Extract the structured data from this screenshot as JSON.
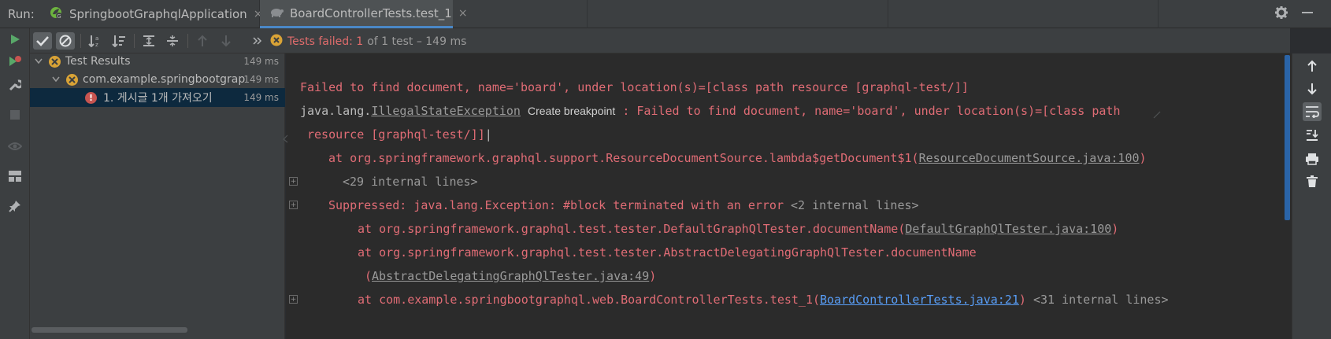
{
  "run_label": "Run:",
  "tabs": [
    {
      "label": "SpringbootGraphqlApplication",
      "close": "×"
    },
    {
      "label": "BoardControllerTests.test_1",
      "close": "×"
    }
  ],
  "status": {
    "failed_text": "Tests failed: 1",
    "rest_text": "of 1 test – 149 ms"
  },
  "tree": {
    "items": [
      {
        "label": "Test Results",
        "time": "149 ms"
      },
      {
        "label": "com.example.springbootgrap",
        "time": "149 ms"
      },
      {
        "label": "1. 게시글 1개 가져오기",
        "time": "149 ms"
      }
    ],
    "err_mark": "!"
  },
  "console": {
    "l1": "Failed to find document, name='board', under location(s)=[class path resource [graphql-test/]]",
    "l2_pre": "java.lang.",
    "l2_link": "IllegalStateException",
    "l2_bp": "Create breakpoint",
    "l2_post": " : Failed to find document, name='board', under location(s)=[class path",
    "l3": "resource [graphql-test/]]",
    "l4_pre": "at org.springframework.graphql.support.ResourceDocumentSource.lambda$getDocument$1(",
    "l4_link": "ResourceDocumentSource.java:100",
    "l4_post": ")",
    "l5": "<29 internal lines>",
    "l6_pre": "Suppressed: java.lang.Exception: #block terminated with an error ",
    "l6_gray": "<2 internal lines>",
    "l7_pre": "at org.springframework.graphql.test.tester.DefaultGraphQlTester.documentName(",
    "l7_link": "DefaultGraphQlTester.java:100",
    "l7_post": ")",
    "l8": "at org.springframework.graphql.test.tester.AbstractDelegatingGraphQlTester.documentName",
    "l9_pre": "(",
    "l9_link": "AbstractDelegatingGraphQlTester.java:49",
    "l9_post": ")",
    "l10_pre": "at com.example.springbootgraphql.web.BoardControllerTests.test_1(",
    "l10_link": "BoardControllerTests.java:21",
    "l10_post": ") ",
    "l10_gray": "<31 internal lines>",
    "fold_mark": "+"
  },
  "colors": {
    "error_text": "#e06c75",
    "failed_status": "#e06c6c",
    "selection": "#0d293e",
    "accent": "#4a88c7",
    "blue_link": "#589df6",
    "warning_badge": "#d9a336"
  },
  "icons": {
    "left": [
      "play-icon",
      "rerun-failed-icon",
      "wrench-icon",
      "stop-icon",
      "eye-icon",
      "layout-icon",
      "pin-icon"
    ],
    "toolbar": [
      "show-passed-icon",
      "show-ignored-icon",
      "sort-alpha-icon",
      "sort-duration-icon",
      "expand-all-icon",
      "collapse-all-icon",
      "prev-failed-icon",
      "next-failed-icon",
      "more-icon"
    ],
    "right": [
      "up-arrow-icon",
      "down-arrow-icon",
      "soft-wrap-icon",
      "scroll-to-end-icon",
      "print-icon",
      "trash-icon"
    ],
    "top": [
      "gear-icon",
      "minimize-icon"
    ]
  }
}
